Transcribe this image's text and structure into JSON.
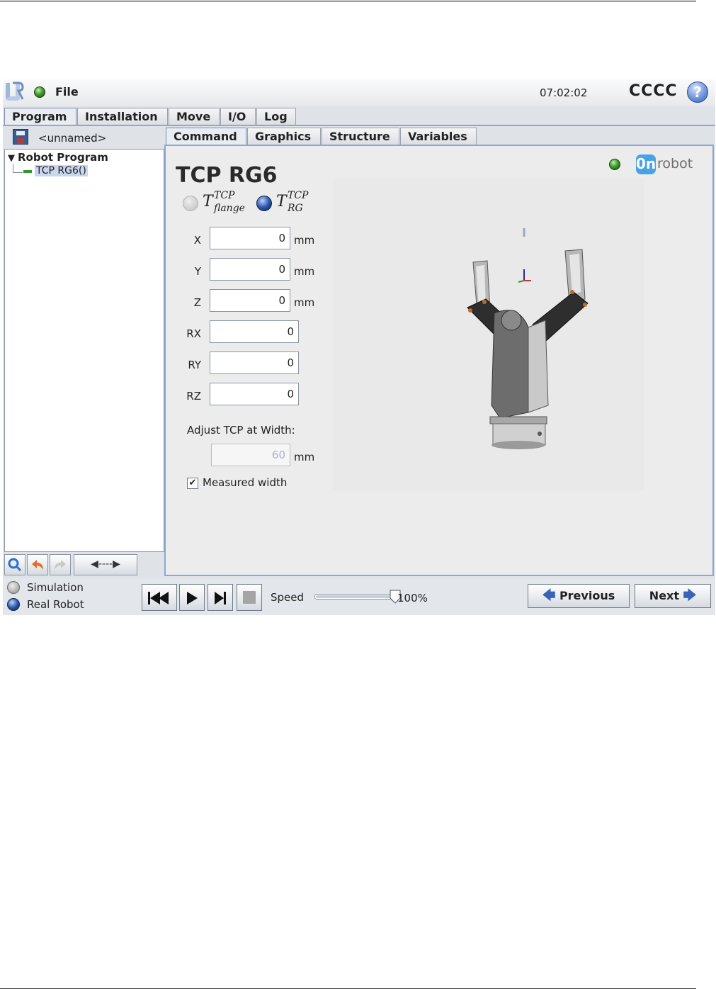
{
  "top_bar": {
    "file_label": "File",
    "time": "07:02:02",
    "robot_name": "CCCC",
    "help_symbol": "?",
    "logo_icon": "ur-logo"
  },
  "main_tabs": [
    {
      "label": "Program",
      "active": true
    },
    {
      "label": "Installation",
      "active": false
    },
    {
      "label": "Move",
      "active": false
    },
    {
      "label": "I/O",
      "active": false
    },
    {
      "label": "Log",
      "active": false
    }
  ],
  "left_panel": {
    "program_name": "<unnamed>",
    "tree": {
      "root": "Robot Program",
      "nodes": [
        "TCP RG6()"
      ]
    },
    "toolbar_icons": [
      "search-icon",
      "undo-icon",
      "redo-icon",
      "move-arrows-icon"
    ],
    "move_label": "◀----▶"
  },
  "sub_tabs": [
    {
      "label": "Command",
      "active": true
    },
    {
      "label": "Graphics",
      "active": false
    },
    {
      "label": "Structure",
      "active": false
    },
    {
      "label": "Variables",
      "active": false
    }
  ],
  "command": {
    "title": "TCP RG6",
    "brand": {
      "badge": "0n",
      "text": "robot"
    },
    "tcp_options": [
      {
        "base": "T",
        "sup": "TCP",
        "sub": "flange",
        "selected": false
      },
      {
        "base": "T",
        "sup": "TCP",
        "sub": "RG",
        "selected": true
      }
    ],
    "fields": [
      {
        "label": "X",
        "value": "0",
        "unit": "mm"
      },
      {
        "label": "Y",
        "value": "0",
        "unit": "mm"
      },
      {
        "label": "Z",
        "value": "0",
        "unit": "mm"
      },
      {
        "label": "RX",
        "value": "0",
        "unit": ""
      },
      {
        "label": "RY",
        "value": "0",
        "unit": ""
      },
      {
        "label": "RZ",
        "value": "0",
        "unit": ""
      }
    ],
    "adjust_label": "Adjust TCP at Width:",
    "width": {
      "value": "60",
      "unit": "mm"
    },
    "measured_width": {
      "label": "Measured width",
      "checked": true
    }
  },
  "bottom_bar": {
    "simulation_label": "Simulation",
    "real_robot_label": "Real Robot",
    "speed_label": "Speed",
    "speed_value": "100%",
    "speed_fraction": 1.0,
    "previous_label": "Previous",
    "next_label": "Next"
  },
  "colors": {
    "accent_blue": "#8ea6d6",
    "led_green": "#3fa02a",
    "onrobot_blue": "#45a3e6"
  }
}
